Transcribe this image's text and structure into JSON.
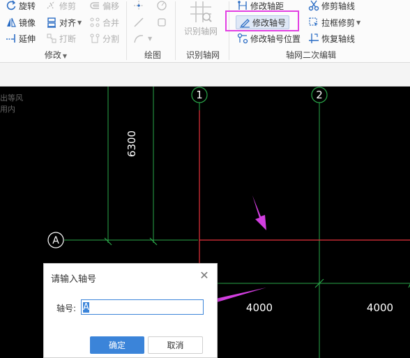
{
  "ribbon": {
    "modify": {
      "rotate": "旋转",
      "trim": "修剪",
      "offset": "偏移",
      "mirror": "镜像",
      "align": "对齐",
      "merge": "合并",
      "extend": "延伸",
      "break": "打断",
      "split": "分割",
      "group_label": "修改"
    },
    "draw": {
      "group_label": "绘图"
    },
    "recognize": {
      "button_label": "识别轴网",
      "group_label": "识别轴网"
    },
    "axis_edit": {
      "modify_spacing": "修改轴距",
      "modify_number": "修改轴号",
      "modify_number_pos": "修改轴号位置",
      "trim_axis": "修剪轴线",
      "box_trim": "拉框修剪",
      "restore_axis": "恢复轴线",
      "group_label": "轴网二次编辑"
    }
  },
  "canvas": {
    "side_text_1": "出等风",
    "side_text_2": "用内",
    "axis_labels": {
      "axis_1": "1",
      "axis_2": "2",
      "axis_a": "A"
    },
    "dimensions": {
      "vertical": "6300",
      "span_1": "4000",
      "span_2": "4000"
    }
  },
  "dialog": {
    "title": "请输入轴号",
    "field_label": "轴号:",
    "field_value": "A",
    "ok_label": "确定",
    "cancel_label": "取消"
  },
  "colors": {
    "canvas_bg": "#000000",
    "axis_red": "#e8323c",
    "dim_green": "#2aa84a",
    "highlight": "#e23fe3",
    "arrow": "#d23ee0",
    "primary_button": "#3b84d9"
  }
}
